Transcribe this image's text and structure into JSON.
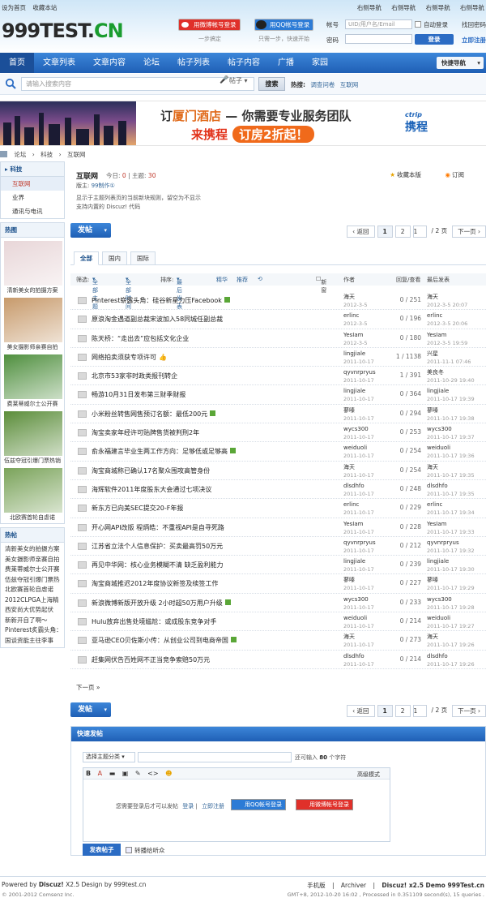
{
  "header": {
    "quick_links": [
      "设为首页",
      "收藏本站"
    ],
    "right_links": [
      "右侧导航",
      "右侧导航",
      "右侧导航",
      "右侧导航"
    ],
    "logo_main": "999TEST.",
    "logo_cn": "CN",
    "weibo_login": "用微博帐号登录",
    "qq_login": "用QQ帐号登录",
    "weibo_sub": "一步搞定",
    "qq_sub": "只需一步，快速开始",
    "login": {
      "account_label": "帐号",
      "account_placeholder": "UID/用户名/Email",
      "auto_login": "自动登录",
      "forget": "找回密码",
      "password_label": "密码",
      "login_button": "登录",
      "register": "立即注册"
    }
  },
  "nav": {
    "items": [
      "首页",
      "文章列表",
      "文章内容",
      "论坛",
      "帖子列表",
      "帖子内容",
      "广播",
      "家园"
    ],
    "quicknav": "快捷导航"
  },
  "search": {
    "placeholder": "请输入搜索内容",
    "type": "帖子",
    "button": "搜索",
    "hot_label": "热搜:",
    "hot_items": [
      "调查问卷",
      "互联网"
    ]
  },
  "banner": {
    "line1_a": "订",
    "line1_em": "厦门酒店",
    "line1_b": " — 你需要专业服务团队",
    "line2": "来携程",
    "line2_pill": "订房2折起！",
    "brand": "ctrip",
    "brand_cn": "携程"
  },
  "breadcrumb": [
    "论坛",
    "›",
    "科技",
    "›",
    "互联网"
  ],
  "sidebar": {
    "category": "科技",
    "items": [
      "互联网",
      "业界",
      "通讯与电讯"
    ],
    "hot_title": "热图",
    "hot_images": [
      {
        "caption": "清新美女的拍摄方案",
        "color": "#e8d6d8"
      },
      {
        "caption": "美女摄影师亲赛自拍",
        "color": "#c79a6b"
      },
      {
        "caption": "费莱蒂威尔士公开赛",
        "color": "#4f8f3e"
      },
      {
        "caption": "伍兹夺冠引爆门票热销",
        "color": "#5b8d3a"
      },
      {
        "caption": "北欧赛首轮自虐诺",
        "color": "#7aa35a"
      }
    ],
    "hot_posts_title": "热帖",
    "hot_posts": [
      "清新美女的拍摄方案",
      "美女摄影师亲赛自拍",
      "费莱蒂威尔士公开赛",
      "伍兹夺冠引爆门票热",
      "北欧赛首轮自虐诺",
      "2012CLPGA上海精",
      "西安尚大优势起伏",
      "新新开自了啊～",
      "Pinterest炙霸头角：",
      "国谈资能主往李事"
    ]
  },
  "forum": {
    "title": "互联网",
    "today_label": "今日:",
    "today": "0",
    "topics_label": "主题:",
    "topics": "30",
    "mod_label": "版主:",
    "mod": "99制作①",
    "rules": [
      "显示于主题列表页的当前新块规则，留空为不显示",
      "支持内置的 Discuz! 代码"
    ],
    "fav": "收藏本版",
    "rss": "订阅",
    "post_button": "发帖",
    "pager": {
      "prev": "‹ 返回",
      "p1": "1",
      "p2": "2",
      "input": "1",
      "total": "/ 2 页",
      "next": "下一页 ›"
    },
    "tabs": [
      "全部",
      "国内",
      "国际"
    ],
    "filter": {
      "label": "筛选:",
      "all_topics": "全部主题",
      "all_time": "全部时间",
      "sort_label": "排序:",
      "sort": "最后发表",
      "digest": "精华",
      "recommend": "推荐",
      "refresh": "⟲",
      "newwin": "新窗",
      "col_author": "作者",
      "col_count": "回复/查看",
      "col_last": "最后发表"
    },
    "threads": [
      {
        "title": "Pinterest崭露头角：硅谷新星力压Facebook",
        "badge": true,
        "author": "海天",
        "date": "2012-3-5",
        "count": "0 / 251",
        "last_user": "海天",
        "last_time": "2012-3-5 20:07"
      },
      {
        "title": "原浪淘金遇道副总裁宋波加入58同城任副总裁",
        "badge": false,
        "author": "erlinc",
        "date": "2012-3-5",
        "count": "0 / 196",
        "last_user": "erlinc",
        "last_time": "2012-3-5 20:06"
      },
      {
        "title": "陈天桥：“走出去”应包括文化企业",
        "badge": false,
        "author": "YesIam",
        "date": "2012-3-5",
        "count": "0 / 180",
        "last_user": "YesIam",
        "last_time": "2012-3-5 19:59"
      },
      {
        "title": "网络拍卖须获专项许可",
        "badge": false,
        "thumb": true,
        "author": "lingjiale",
        "date": "2011-10-17",
        "count": "1 / 1138",
        "last_user": "兴星",
        "last_time": "2011-11-1 07:46"
      },
      {
        "title": "北京市53家非时政类报刊转企",
        "badge": false,
        "author": "qyvnrpryus",
        "date": "2011-10-17",
        "count": "1 / 391",
        "last_user": "美良冬",
        "last_time": "2011-10-29 19:40"
      },
      {
        "title": "畅游10月31日发布第三财季财报",
        "badge": false,
        "author": "lingjiale",
        "date": "2011-10-17",
        "count": "0 / 364",
        "last_user": "lingjiale",
        "last_time": "2011-10-17 19:39"
      },
      {
        "title": "小米粉丝转售网售预订名额：最低200元",
        "badge": true,
        "author": "蓼嗪",
        "date": "2011-10-17",
        "count": "0 / 294",
        "last_user": "蓼嗪",
        "last_time": "2011-10-17 19:38"
      },
      {
        "title": "淘宝卖家年经许可贴牌售货被判刑2年",
        "badge": false,
        "author": "wycs300",
        "date": "2011-10-17",
        "count": "0 / 253",
        "last_user": "wycs300",
        "last_time": "2011-10-17 19:37"
      },
      {
        "title": "俞永福建言毕业生两工作方向：足够低或足够高",
        "badge": true,
        "author": "weiduoli",
        "date": "2011-10-17",
        "count": "0 / 254",
        "last_user": "weiduoli",
        "last_time": "2011-10-17 19:36"
      },
      {
        "title": "淘宝商城称已确认17名聚众围攻高管身份",
        "badge": false,
        "author": "海天",
        "date": "2011-10-17",
        "count": "0 / 254",
        "last_user": "海天",
        "last_time": "2011-10-17 19:35"
      },
      {
        "title": "海辉软件2011年度股东大会通过七项决议",
        "badge": false,
        "author": "dlsdhfo",
        "date": "2011-10-17",
        "count": "0 / 248",
        "last_user": "dlsdhfo",
        "last_time": "2011-10-17 19:35"
      },
      {
        "title": "新东方已向美SEC提交20-F年报",
        "badge": false,
        "author": "erlinc",
        "date": "2011-10-17",
        "count": "0 / 229",
        "last_user": "erlinc",
        "last_time": "2011-10-17 19:34"
      },
      {
        "title": "开心网API改版 程炳皓：不重视API是自寻死路",
        "badge": false,
        "author": "YesIam",
        "date": "2011-10-17",
        "count": "0 / 228",
        "last_user": "YesIam",
        "last_time": "2011-10-17 19:33"
      },
      {
        "title": "江苏省立法个人信息保护：买卖最高罚50万元",
        "badge": false,
        "author": "qyvnrpryus",
        "date": "2011-10-17",
        "count": "0 / 212",
        "last_user": "qyvnrpryus",
        "last_time": "2011-10-17 19:32"
      },
      {
        "title": "再见中华网：核心业务模糊不清 缺乏盈利能力",
        "badge": false,
        "author": "lingjiale",
        "date": "2011-10-17",
        "count": "0 / 239",
        "last_user": "lingjiale",
        "last_time": "2011-10-17 19:30"
      },
      {
        "title": "淘宝商城推迟2012年度协议新签及续签工作",
        "badge": false,
        "author": "蓼嗪",
        "date": "2011-10-17",
        "count": "0 / 227",
        "last_user": "蓼嗪",
        "last_time": "2011-10-17 19:29"
      },
      {
        "title": "新浪微博新版开放升级 2小时超50万用户升级",
        "badge": true,
        "author": "wycs300",
        "date": "2011-10-17",
        "count": "0 / 233",
        "last_user": "wycs300",
        "last_time": "2011-10-17 19:28"
      },
      {
        "title": "Hulu放弃出售处境尴尬：或成股东竞争对手",
        "badge": false,
        "author": "weiduoli",
        "date": "2011-10-17",
        "count": "0 / 214",
        "last_user": "weiduoli",
        "last_time": "2011-10-17 19:27"
      },
      {
        "title": "亚马逊CEO贝佐斯小传：从创业公司到电商帝国",
        "badge": true,
        "author": "海天",
        "date": "2011-10-17",
        "count": "0 / 273",
        "last_user": "海天",
        "last_time": "2011-10-17 19:26"
      },
      {
        "title": "赶集网伏告百姓网不正当竞争索赔50万元",
        "badge": false,
        "author": "dlsdhfo",
        "date": "2011-10-17",
        "count": "0 / 214",
        "last_user": "dlsdhfo",
        "last_time": "2011-10-17 19:26"
      }
    ],
    "next_page": "下一页 »"
  },
  "quick_post": {
    "title": "快速发帖",
    "select": "选择主题分类",
    "limit_a": "还可输入",
    "limit_n": "80",
    "limit_b": "个字符",
    "toolbar": [
      "B",
      "A",
      "▬",
      "▣",
      "✎",
      "<>",
      "☻"
    ],
    "advanced": "高级模式",
    "need_login": "您需要登录后才可以发帖",
    "login": "登录",
    "sep": "|",
    "register": "立即注册",
    "qq": "用QQ帐号登录",
    "weibo": "用微博帐号登录",
    "submit": "发表帖子",
    "share": "转播给听众"
  },
  "footer": {
    "powered_a": "Powered by ",
    "powered_b": "Discuz!",
    "powered_c": " X2.5 Design by 999test.cn",
    "copyright": "© 2001-2012 Comsenz Inc.",
    "links": [
      "手机版",
      "|",
      "Archiver",
      "|",
      "Discuz! x2.5 Demo 999Test.cn"
    ],
    "gmt": "GMT+8, 2012-10-20 16:02 , Processed in 0.351109 second(s), 15 queries ."
  }
}
